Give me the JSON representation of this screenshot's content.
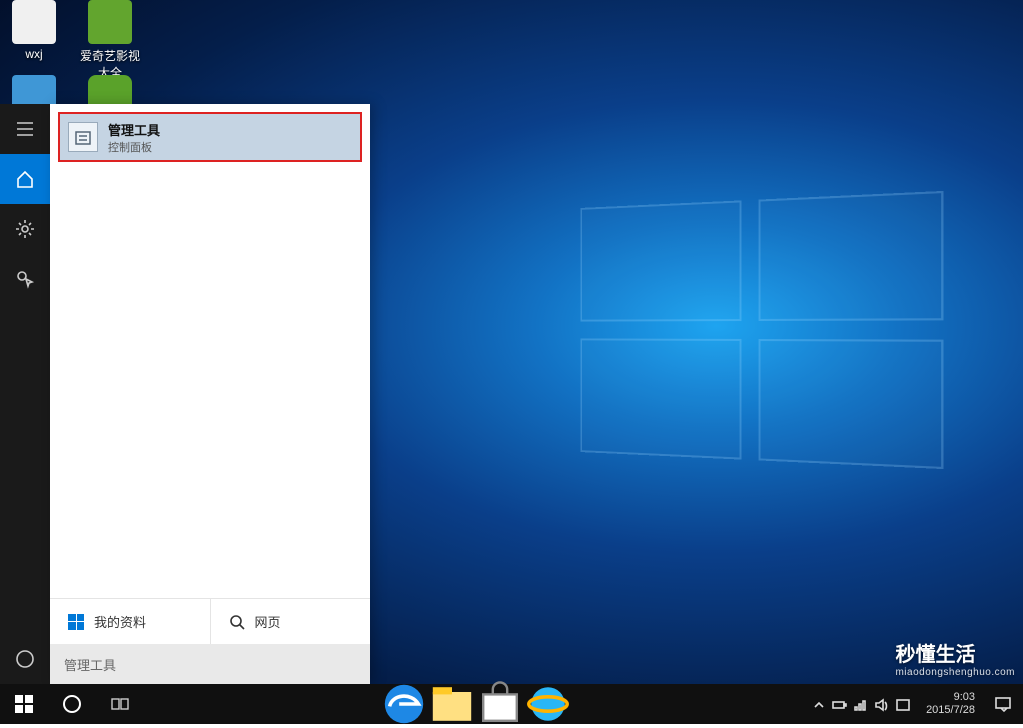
{
  "desktop_icons": {
    "i1": "wxj",
    "i2": "爱奇艺影视大全",
    "i3": "",
    "i4": ""
  },
  "search": {
    "result_title": "管理工具",
    "result_subtitle": "控制面板",
    "tabs": {
      "my_stuff": "我的资料",
      "web": "网页"
    },
    "query": "管理工具"
  },
  "tray": {
    "time": "9:03",
    "date": "2015/7/28"
  },
  "watermark": {
    "brand": "秒懂生活",
    "url": "miaodongshenghuo.com"
  },
  "icons": {
    "hamburger": "hamburger-icon",
    "home": "home-icon",
    "gear": "gear-icon",
    "feedback": "feedback-icon",
    "cortana": "cortana-circle-icon",
    "admin_tools": "admin-tools-icon",
    "search": "search-icon",
    "start": "start-icon",
    "taskview": "taskview-icon",
    "edge": "edge-icon",
    "explorer": "explorer-icon",
    "store": "store-icon",
    "ie": "ie-icon",
    "chevron_up": "chevron-up-icon",
    "battery": "battery-icon",
    "volume": "volume-icon",
    "network": "network-icon",
    "ime": "ime-icon",
    "action_center": "action-center-icon"
  }
}
